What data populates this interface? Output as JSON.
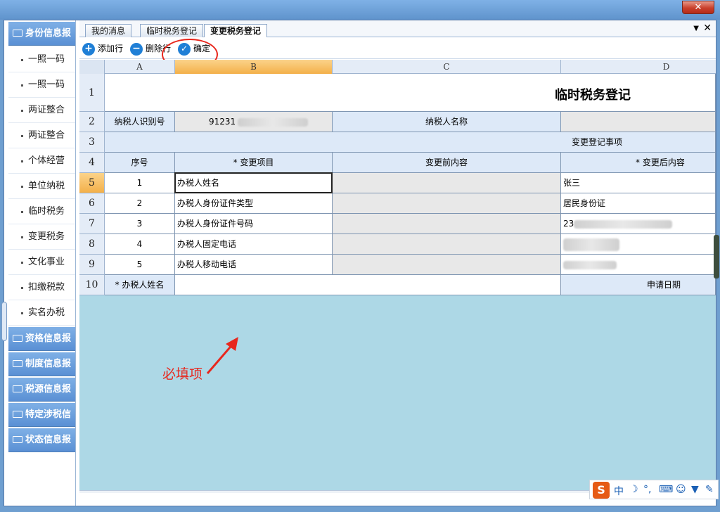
{
  "window": {
    "close_label": "✕"
  },
  "nav": {
    "sections_top": [
      {
        "label": "身份信息报"
      }
    ],
    "items": [
      {
        "label": "一照一码"
      },
      {
        "label": "一照一码"
      },
      {
        "label": "两证整合"
      },
      {
        "label": "两证整合"
      },
      {
        "label": "个体经营"
      },
      {
        "label": "单位纳税"
      },
      {
        "label": "临时税务"
      },
      {
        "label": "变更税务"
      },
      {
        "label": "文化事业"
      },
      {
        "label": "扣缴税款"
      },
      {
        "label": "实名办税"
      }
    ],
    "sections_bottom": [
      {
        "label": "资格信息报"
      },
      {
        "label": "制度信息报"
      },
      {
        "label": "税源信息报"
      },
      {
        "label": "特定涉税信"
      },
      {
        "label": "状态信息报"
      }
    ]
  },
  "tabs": [
    {
      "label": "我的消息"
    },
    {
      "label": "临时税务登记"
    },
    {
      "label": "变更税务登记"
    }
  ],
  "tab_menu": "▼",
  "tab_close": "✕",
  "toolbar": {
    "add_row": "添加行",
    "delete_row": "删除行",
    "confirm": "确定"
  },
  "sheet": {
    "columns": [
      "A",
      "B",
      "C",
      "D"
    ],
    "rows": [
      "1",
      "2",
      "3",
      "4",
      "5",
      "6",
      "7",
      "8",
      "9",
      "10"
    ],
    "title": "临时税务登记",
    "taxpayer_id_label": "纳税人识别号",
    "taxpayer_id_value": "91231",
    "taxpayer_name_label": "纳税人名称",
    "section_label": "变更登记事项",
    "header_seq": "序号",
    "header_item": "* 变更项目",
    "header_before": "变更前内容",
    "header_after": "* 变更后内容",
    "items": [
      {
        "seq": "1",
        "item": "办税人姓名",
        "after": "张三"
      },
      {
        "seq": "2",
        "item": "办税人身份证件类型",
        "after": "居民身份证"
      },
      {
        "seq": "3",
        "item": "办税人身份证件号码",
        "after": "23"
      },
      {
        "seq": "4",
        "item": "办税人固定电话",
        "after": ""
      },
      {
        "seq": "5",
        "item": "办税人移动电话",
        "after": ""
      }
    ],
    "handler_name_label": "* 办税人姓名",
    "apply_date_label": "申请日期"
  },
  "annotation": {
    "text": "必填项",
    "color": "#e8271d"
  },
  "ime": {
    "logo": "S",
    "lang": "中"
  }
}
